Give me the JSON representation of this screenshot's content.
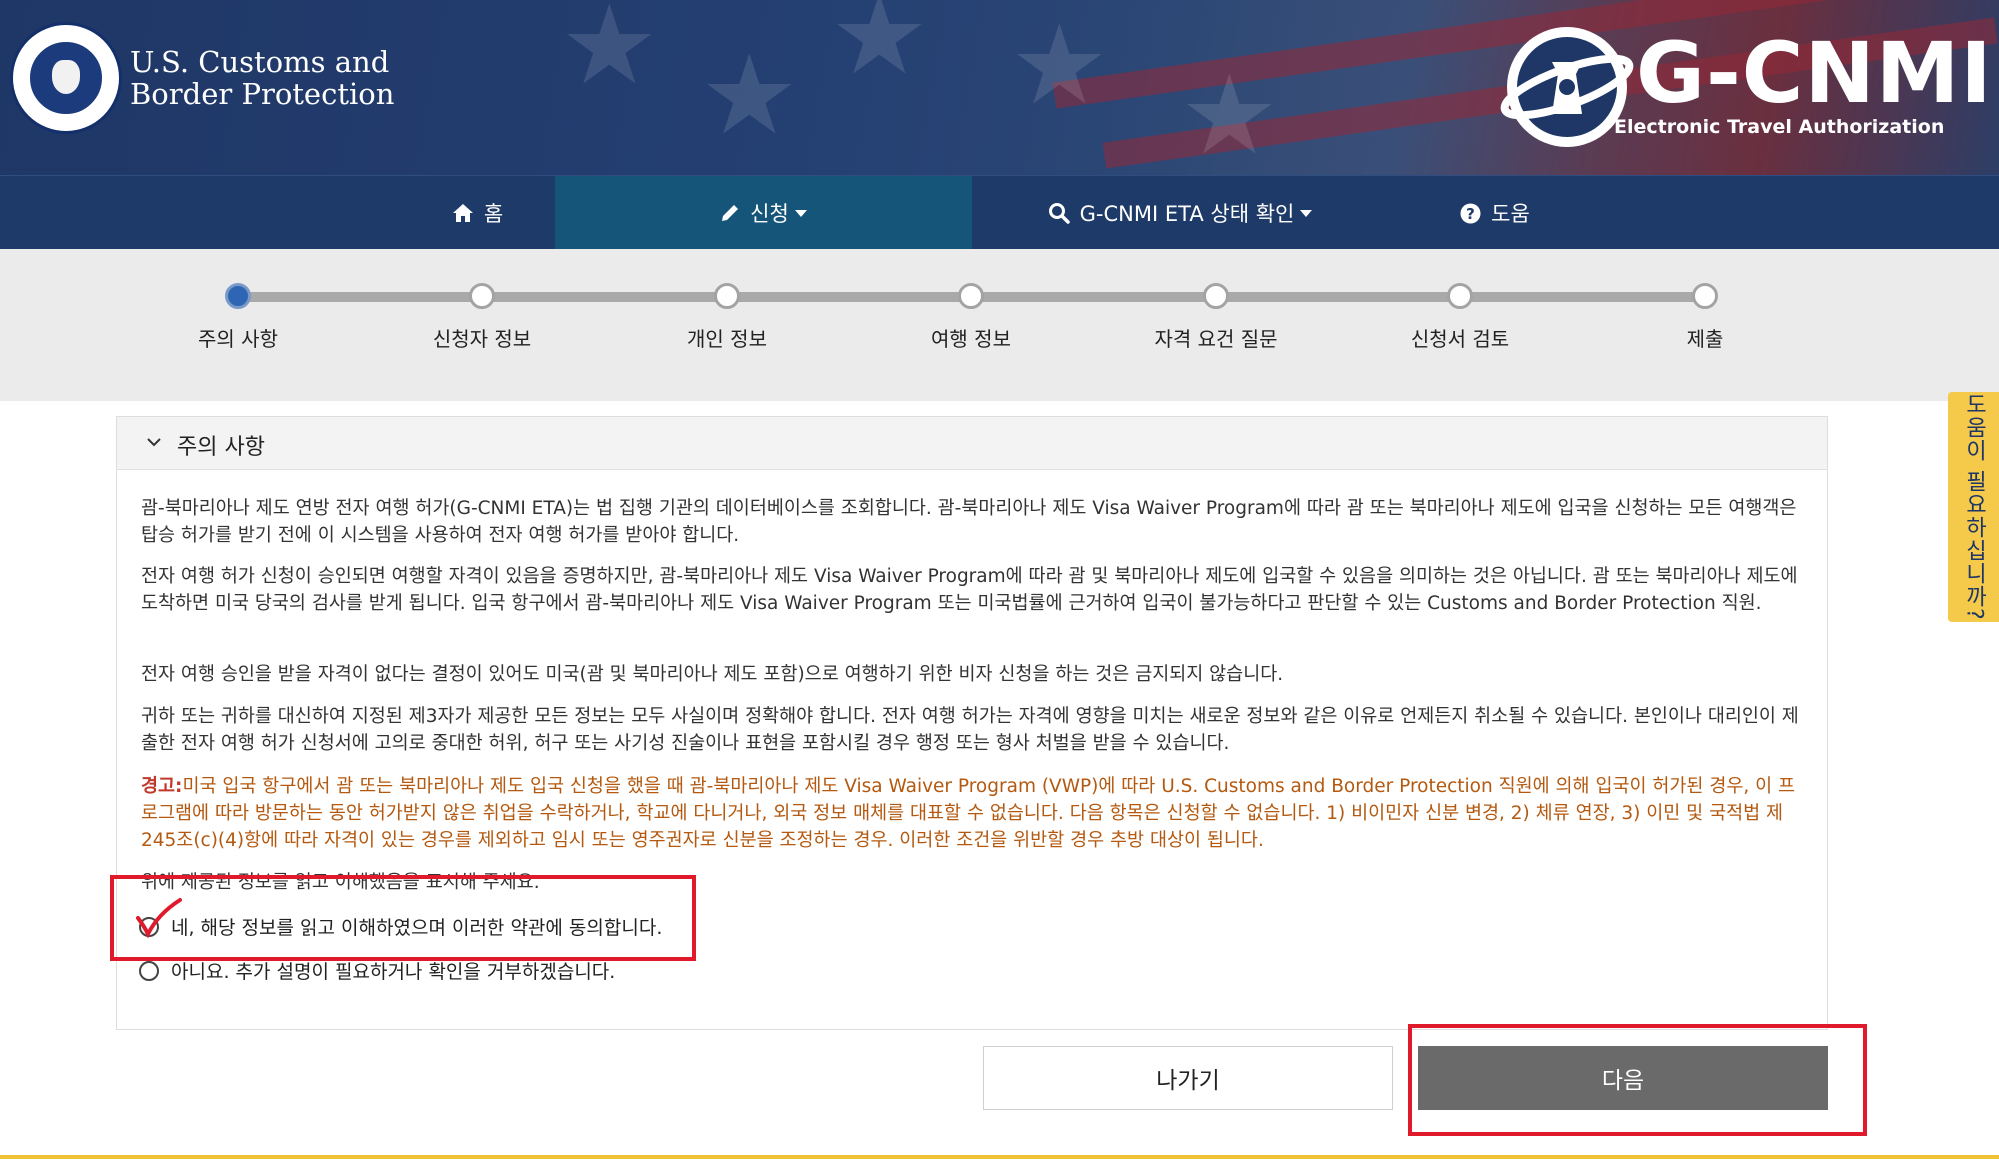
{
  "header": {
    "agency_line1": "U.S. Customs and",
    "agency_line2": "Border Protection",
    "brand_name": "G-CNMI",
    "brand_subtitle": "Electronic Travel Authorization"
  },
  "nav": {
    "items": [
      {
        "label": "홈",
        "icon": "home-icon"
      },
      {
        "label": "신청",
        "icon": "pencil-icon",
        "active": true,
        "dropdown": true
      },
      {
        "label": "G-CNMI ETA 상태 확인",
        "icon": "search-icon",
        "dropdown": true
      },
      {
        "label": "도움",
        "icon": "question-circle-icon"
      }
    ]
  },
  "progress": {
    "current_step": 1,
    "steps": [
      "주의 사항",
      "신청자 정보",
      "개인 정보",
      "여행 정보",
      "자격 요건 질문",
      "신청서 검토",
      "제출"
    ]
  },
  "help_tab": {
    "label": "도움이 필요하십니까?"
  },
  "notice": {
    "section_title": "주의 사항",
    "paragraphs": [
      "괌-북마리아나 제도 연방 전자 여행 허가(G-CNMI ETA)는 법 집행 기관의 데이터베이스를 조회합니다. 괌-북마리아나 제도 Visa Waiver Program에 따라 괌 또는 북마리아나 제도에 입국을 신청하는 모든 여행객은 탑승 허가를 받기 전에 이 시스템을 사용하여 전자 여행 허가를 받아야 합니다.",
      "전자 여행 허가 신청이 승인되면 여행할 자격이 있음을 증명하지만, 괌-북마리아나 제도 Visa Waiver Program에 따라 괌 및 북마리아나 제도에 입국할 수 있음을 의미하는 것은 아닙니다. 괌 또는 북마리아나 제도에 도착하면 미국 당국의 검사를 받게 됩니다. 입국 항구에서 괌-북마리아나 제도 Visa Waiver Program 또는 미국법률에 근거하여 입국이 불가능하다고 판단할 수 있는 Customs and Border Protection 직원.",
      "전자 여행 승인을 받을 자격이 없다는 결정이 있어도 미국(괌 및 북마리아나 제도 포함)으로 여행하기 위한 비자 신청을 하는 것은 금지되지 않습니다.",
      "귀하 또는 귀하를 대신하여 지정된 제3자가 제공한 모든 정보는 모두 사실이며 정확해야 합니다. 전자 여행 허가는 자격에 영향을 미치는 새로운 정보와 같은 이유로 언제든지 취소될 수 있습니다. 본인이나 대리인이 제출한 전자 여행 허가 신청서에 고의로 중대한 허위, 허구 또는 사기성 진술이나 표현을 포함시킬 경우 행정 또는 형사 처벌을 받을 수 있습니다."
    ],
    "warning_label": "경고:",
    "warning_text": "미국 입국 항구에서 괌 또는 북마리아나 제도 입국 신청을 했을 때 괌-북마리아나 제도 Visa Waiver Program (VWP)에 따라 U.S. Customs and Border Protection 직원에 의해 입국이 허가된 경우, 이 프로그램에 따라 방문하는 동안 허가받지 않은 취업을 수락하거나, 학교에 다니거나, 외국 정보 매체를 대표할 수 없습니다. 다음 항목은 신청할 수 없습니다. 1) 비이민자 신분 변경, 2) 체류 연장, 3) 이민 및 국적법 제 245조(c)(4)항에 따라 자격이 있는 경우를 제외하고 임시 또는 영주권자로 신분을 조정하는 경우. 이러한 조건을 위반할 경우 추방 대상이 됩니다.",
    "acknowledge_prompt": "위에 제공된 정보를 읽고 이해했음을 표시해 주세요.",
    "option_yes": "네, 해당 정보를 읽고 이해하였으며 이러한 약관에 동의합니다.",
    "option_no": "아니요. 추가 설명이 필요하거나 확인을 거부하겠습니다."
  },
  "buttons": {
    "exit": "나가기",
    "next": "다음"
  },
  "colors": {
    "header_navy": "#1f3766",
    "nav_active": "#15557a",
    "warning": "#b4590f",
    "annotation_red": "#e01a2b",
    "help_tab": "#f5c94a",
    "next_button": "#6a6a6a"
  }
}
